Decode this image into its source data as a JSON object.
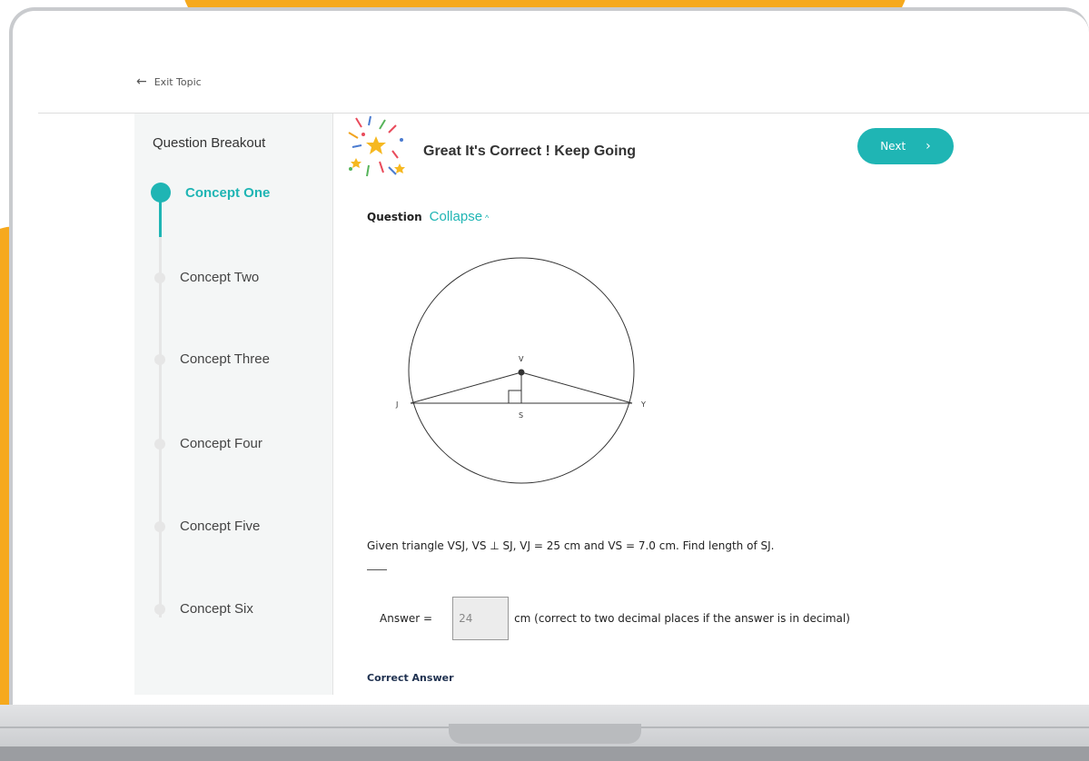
{
  "header": {
    "exit_label": "Exit Topic"
  },
  "sidebar": {
    "title": "Question Breakout",
    "concepts": [
      {
        "label": "Concept One",
        "active": true
      },
      {
        "label": "Concept Two",
        "active": false
      },
      {
        "label": "Concept Three",
        "active": false
      },
      {
        "label": "Concept Four",
        "active": false
      },
      {
        "label": "Concept Five",
        "active": false
      },
      {
        "label": "Concept Six",
        "active": false
      }
    ]
  },
  "feedback": {
    "message": "Great It's Correct ! Keep Going",
    "next_label": "Next"
  },
  "question": {
    "label": "Question",
    "collapse_label": "Collapse",
    "diagram_labels": {
      "v": "V",
      "j": "J",
      "s": "S",
      "y": "Y"
    },
    "problem_text": "Given triangle VSJ, VS  ⊥  SJ, VJ = 25 cm and VS = 7.0 cm. Find length of SJ.",
    "answer_label": "Answer =",
    "answer_value": "24",
    "answer_suffix": "cm (correct to two decimal places if the answer is in decimal)",
    "correct_answer_label": "Correct Answer"
  },
  "colors": {
    "accent": "#1fb5b4",
    "backdrop": "#f6a91d"
  }
}
